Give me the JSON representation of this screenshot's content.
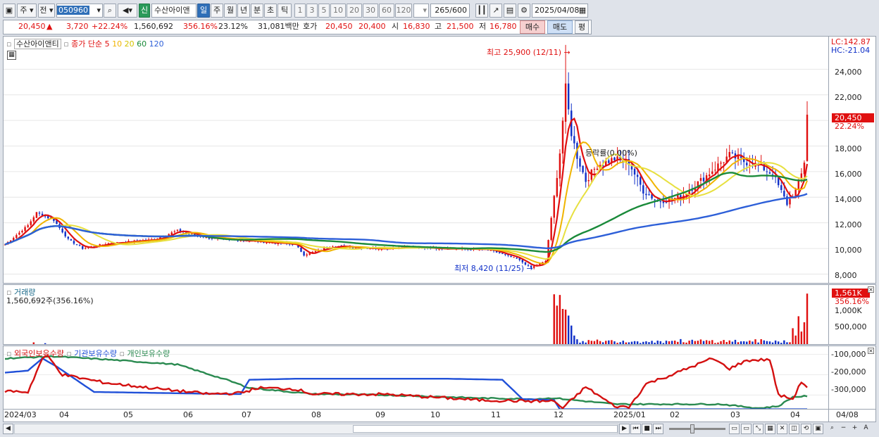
{
  "toolbar": {
    "market_type": "주",
    "market_scope": "전",
    "stock_code": "050960",
    "stock_name_badge": "신",
    "stock_name": "수산아이앤",
    "periods": [
      "일",
      "주",
      "월",
      "년",
      "분",
      "초",
      "틱"
    ],
    "intervals": [
      "1",
      "3",
      "5",
      "10",
      "20",
      "30",
      "60",
      "120"
    ],
    "count_value": "265",
    "count_total": "/600",
    "date": "2025/04/08"
  },
  "quote": {
    "price": "20,450",
    "change": "3,720",
    "change_pct": "+22.24%",
    "volume": "1,560,692",
    "volume_ratio": "356.16%",
    "turnover": "23.12%",
    "amount": "31,081백만",
    "hoga_label": "호가",
    "ask": "20,450",
    "bid": "20,400",
    "open_label": "시",
    "open": "16,830",
    "high_label": "고",
    "high": "21,500",
    "low_label": "저",
    "low": "16,780",
    "buy_label": "매수",
    "sell_label": "매도",
    "eval_label": "평"
  },
  "price_panel": {
    "stock_label": "수산아이앤티",
    "ma_label": "종가 단순",
    "ma_periods": [
      {
        "label": "5",
        "color": "#e01010"
      },
      {
        "label": "10",
        "color": "#f0b400"
      },
      {
        "label": "20",
        "color": "#e7e040"
      },
      {
        "label": "60",
        "color": "#1a8a3a"
      },
      {
        "label": "120",
        "color": "#2d5fd8"
      }
    ],
    "lc_label": "LC:142.87",
    "hc_label": "HC:-21.04",
    "current_price_tag": "20,450",
    "current_pct_tag": "22.24%",
    "high_annotation": "최고 25,900 (12/11)",
    "low_annotation": "최저 8,420 (11/25)",
    "mid_annotation": "등락률(0.00%)",
    "y_ticks": [
      8000,
      10000,
      12000,
      14000,
      16000,
      18000,
      20000,
      22000,
      24000
    ],
    "y_tick_labels": [
      "8,000",
      "10,000",
      "12,000",
      "14,000",
      "16,000",
      "18,000",
      "20,000",
      "22,000",
      "24,000"
    ]
  },
  "volume_panel": {
    "title": "거래량",
    "value_label": "1,560,692주(356.16%)",
    "current_tag": "1,561K",
    "current_pct": "356.16%",
    "y_tick_labels": [
      "500,000",
      "1,000K"
    ]
  },
  "holding_panel": {
    "series_labels": [
      "외국인보유수량",
      "기관보유수량",
      "개인보유수량"
    ],
    "y_tick_labels": [
      "-100,000",
      "-200,000",
      "-300,000"
    ]
  },
  "x_axis": {
    "labels": [
      "2024/03",
      "04",
      "05",
      "06",
      "07",
      "08",
      "09",
      "10",
      "11",
      "12",
      "2025/01",
      "02",
      "03",
      "04"
    ],
    "right_label": "04/08"
  },
  "colors": {
    "up": "#e01010",
    "down": "#1030c8",
    "foreign": "#d41010",
    "institution": "#2050d8",
    "individual": "#2a8a50"
  },
  "chart_data": {
    "type": "candlestick",
    "start": "2024-03-13",
    "end": "2025-04-08",
    "ylim": [
      7200,
      26000
    ],
    "anchors": [
      [
        "2024-03-13",
        10300
      ],
      [
        "2024-03-25",
        11800
      ],
      [
        "2024-03-28",
        12800
      ],
      [
        "2024-04-05",
        12200
      ],
      [
        "2024-04-12",
        10700
      ],
      [
        "2024-04-19",
        10000
      ],
      [
        "2024-05-02",
        10400
      ],
      [
        "2024-05-24",
        10700
      ],
      [
        "2024-06-05",
        11400
      ],
      [
        "2024-06-20",
        10800
      ],
      [
        "2024-07-10",
        10600
      ],
      [
        "2024-08-01",
        10300
      ],
      [
        "2024-08-06",
        9500
      ],
      [
        "2024-08-20",
        10200
      ],
      [
        "2024-09-10",
        10000
      ],
      [
        "2024-09-25",
        10100
      ],
      [
        "2024-10-15",
        10000
      ],
      [
        "2024-11-04",
        9900
      ],
      [
        "2024-11-18",
        9200
      ],
      [
        "2024-11-25",
        8500
      ],
      [
        "2024-12-02",
        9000
      ],
      [
        "2024-12-05",
        14000
      ],
      [
        "2024-12-09",
        17500
      ],
      [
        "2024-12-11",
        22500
      ],
      [
        "2024-12-13",
        19000
      ],
      [
        "2024-12-17",
        17200
      ],
      [
        "2024-12-20",
        15300
      ],
      [
        "2024-12-26",
        16500
      ],
      [
        "2025-01-03",
        17000
      ],
      [
        "2025-01-10",
        16700
      ],
      [
        "2025-01-17",
        14500
      ],
      [
        "2025-01-24",
        13700
      ],
      [
        "2025-02-05",
        14000
      ],
      [
        "2025-02-17",
        15500
      ],
      [
        "2025-02-28",
        17300
      ],
      [
        "2025-03-07",
        16800
      ],
      [
        "2025-03-14",
        16500
      ],
      [
        "2025-03-21",
        15800
      ],
      [
        "2025-03-28",
        13500
      ],
      [
        "2025-04-02",
        14500
      ],
      [
        "2025-04-04",
        15800
      ],
      [
        "2025-04-07",
        16800
      ],
      [
        "2025-04-08",
        20450
      ]
    ],
    "last_candle": {
      "date": "2025-04-08",
      "open": 16830,
      "high": 21500,
      "low": 16780,
      "close": 20450,
      "volume": 1560692
    },
    "volume_spikes": [
      [
        "2024-03-27",
        95000
      ],
      [
        "2024-04-02",
        70000
      ],
      [
        "2024-12-05",
        1540000
      ],
      [
        "2024-12-06",
        1200000
      ],
      [
        "2024-12-09",
        1520000
      ],
      [
        "2024-12-10",
        1100000
      ],
      [
        "2024-12-11",
        1080000
      ],
      [
        "2024-12-12",
        900000
      ],
      [
        "2024-12-13",
        600000
      ],
      [
        "2024-12-16",
        300000
      ],
      [
        "2025-04-01",
        520000
      ],
      [
        "2025-04-02",
        300000
      ],
      [
        "2025-04-03",
        880000
      ],
      [
        "2025-04-04",
        420000
      ],
      [
        "2025-04-07",
        700000
      ],
      [
        "2025-04-08",
        1560692
      ]
    ],
    "holdings": {
      "ylim": [
        -375000,
        -60000
      ],
      "foreign": [
        [
          "2024-03-13",
          -280000
        ],
        [
          "2024-03-25",
          -285000
        ],
        [
          "2024-04-01",
          -120000
        ],
        [
          "2024-04-03",
          -110000
        ],
        [
          "2024-04-10",
          -200000
        ],
        [
          "2024-05-01",
          -240000
        ],
        [
          "2024-06-01",
          -275000
        ],
        [
          "2024-06-20",
          -295000
        ],
        [
          "2024-07-05",
          -290000
        ],
        [
          "2024-07-15",
          -265000
        ],
        [
          "2024-08-01",
          -270000
        ],
        [
          "2024-08-10",
          -295000
        ],
        [
          "2024-09-15",
          -297000
        ],
        [
          "2024-10-30",
          -325000
        ],
        [
          "2024-11-25",
          -330000
        ],
        [
          "2024-12-05",
          -330000
        ],
        [
          "2024-12-10",
          -365000
        ],
        [
          "2024-12-20",
          -260000
        ],
        [
          "2025-01-03",
          -355000
        ],
        [
          "2025-01-10",
          -360000
        ],
        [
          "2025-01-20",
          -245000
        ],
        [
          "2025-02-01",
          -200000
        ],
        [
          "2025-02-20",
          -120000
        ],
        [
          "2025-03-01",
          -170000
        ],
        [
          "2025-03-10",
          -130000
        ],
        [
          "2025-03-20",
          -125000
        ],
        [
          "2025-03-25",
          -300000
        ],
        [
          "2025-04-01",
          -320000
        ],
        [
          "2025-04-04",
          -235000
        ],
        [
          "2025-04-08",
          -260000
        ]
      ],
      "institution": [
        [
          "2024-03-13",
          -190000
        ],
        [
          "2024-03-25",
          -180000
        ],
        [
          "2024-04-01",
          -120000
        ],
        [
          "2024-04-08",
          -160000
        ],
        [
          "2024-04-25",
          -285000
        ],
        [
          "2024-06-28",
          -295000
        ],
        [
          "2024-07-05",
          -295000
        ],
        [
          "2024-07-10",
          -225000
        ],
        [
          "2024-08-01",
          -220000
        ],
        [
          "2024-10-15",
          -220000
        ],
        [
          "2024-11-10",
          -225000
        ],
        [
          "2024-11-20",
          -320000
        ],
        [
          "2024-12-05",
          -325000
        ],
        [
          "2024-12-09",
          -370000
        ],
        [
          "2025-04-08",
          -370000
        ]
      ],
      "individual": [
        [
          "2024-03-13",
          -120000
        ],
        [
          "2024-03-25",
          -115000
        ],
        [
          "2024-04-05",
          -110000
        ],
        [
          "2024-05-01",
          -125000
        ],
        [
          "2024-06-05",
          -150000
        ],
        [
          "2024-06-28",
          -225000
        ],
        [
          "2024-07-10",
          -265000
        ],
        [
          "2024-08-10",
          -295000
        ],
        [
          "2024-09-15",
          -300000
        ],
        [
          "2024-10-30",
          -315000
        ],
        [
          "2024-11-25",
          -320000
        ],
        [
          "2024-12-05",
          -315000
        ],
        [
          "2025-01-03",
          -345000
        ],
        [
          "2025-02-01",
          -345000
        ],
        [
          "2025-02-25",
          -345000
        ],
        [
          "2025-03-15",
          -365000
        ],
        [
          "2025-03-25",
          -355000
        ],
        [
          "2025-04-01",
          -310000
        ],
        [
          "2025-04-08",
          -305000
        ]
      ]
    }
  }
}
